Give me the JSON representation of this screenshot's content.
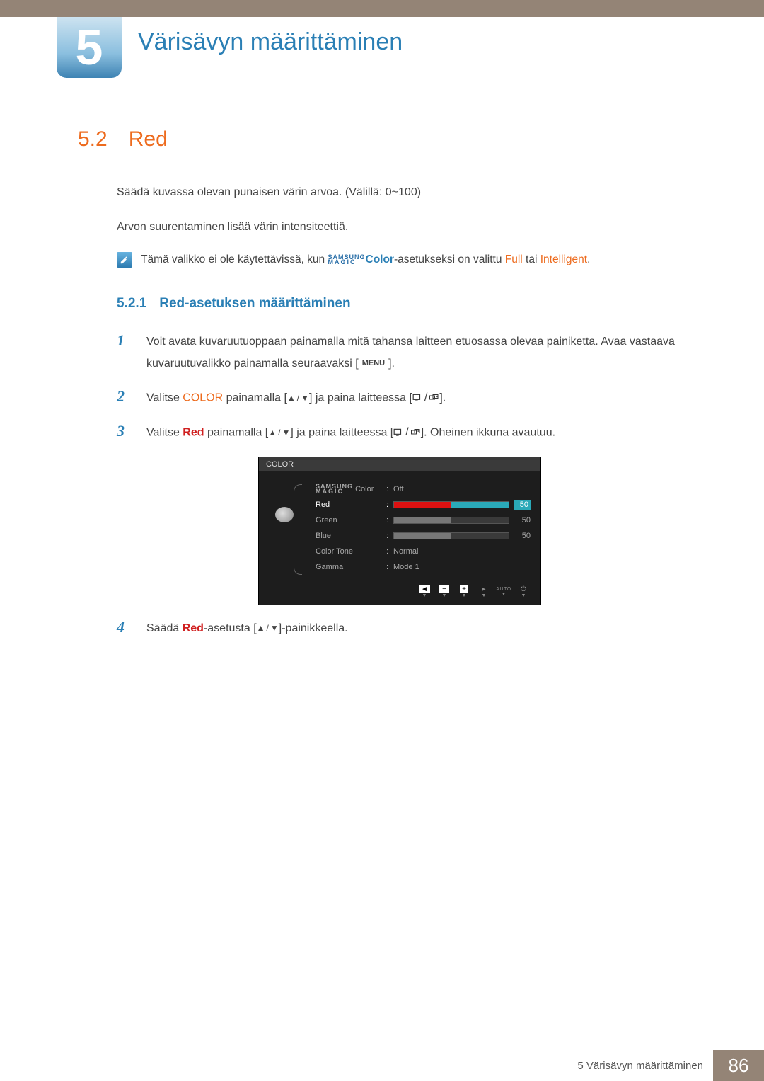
{
  "chapter": {
    "number": "5",
    "title": "Värisävyn määrittäminen"
  },
  "section": {
    "number": "5.2",
    "title": "Red"
  },
  "intro": {
    "p1": "Säädä kuvassa olevan punaisen värin arvoa. (Välillä: 0~100)",
    "p2": "Arvon suurentaminen lisää värin intensiteettiä."
  },
  "note": {
    "pre": "Tämä valikko ei ole käytettävissä, kun ",
    "brand_top": "SAMSUNG",
    "brand_bottom": "MAGIC",
    "brand_word": "Color",
    "mid": "-asetukseksi on valittu ",
    "full": "Full",
    "or": " tai ",
    "intelligent": "Intelligent",
    "end": "."
  },
  "subsection": {
    "number": "5.2.1",
    "title": "Red-asetuksen määrittäminen"
  },
  "steps": [
    {
      "num": "1",
      "text": "Voit avata kuvaruutuoppaan painamalla mitä tahansa laitteen etuosassa olevaa painiketta. Avaa vastaava kuvaruutuvalikko painamalla seuraavaksi [",
      "menu": "MENU",
      "text2": "]."
    },
    {
      "num": "2",
      "pre": "Valitse ",
      "kw": "COLOR",
      "mid": " painamalla [",
      "after1": "] ja paina laitteessa [",
      "after2": "]."
    },
    {
      "num": "3",
      "pre": "Valitse ",
      "kw": "Red",
      "mid": " painamalla [",
      "after1": "] ja paina laitteessa [",
      "after2": "]. Oheinen ikkuna avautuu."
    },
    {
      "num": "4",
      "pre": "Säädä ",
      "kw": "Red",
      "mid": "-asetusta [",
      "after1": "]-painikkeella."
    }
  ],
  "osd": {
    "title": "COLOR",
    "items": [
      {
        "label": "Color",
        "brand_top": "SAMSUNG",
        "brand_bottom": "MAGIC",
        "value": "Off",
        "type": "text"
      },
      {
        "label": "Red",
        "value": "50",
        "type": "slider",
        "selected": true,
        "fill": "red"
      },
      {
        "label": "Green",
        "value": "50",
        "type": "slider",
        "fill": "gray"
      },
      {
        "label": "Blue",
        "value": "50",
        "type": "slider",
        "fill": "gray"
      },
      {
        "label": "Color Tone",
        "value": "Normal",
        "type": "text"
      },
      {
        "label": "Gamma",
        "value": "Mode 1",
        "type": "text"
      }
    ],
    "footer": {
      "auto": "AUTO"
    }
  },
  "footer": {
    "text": "5 Värisävyn määrittäminen",
    "page": "86"
  }
}
